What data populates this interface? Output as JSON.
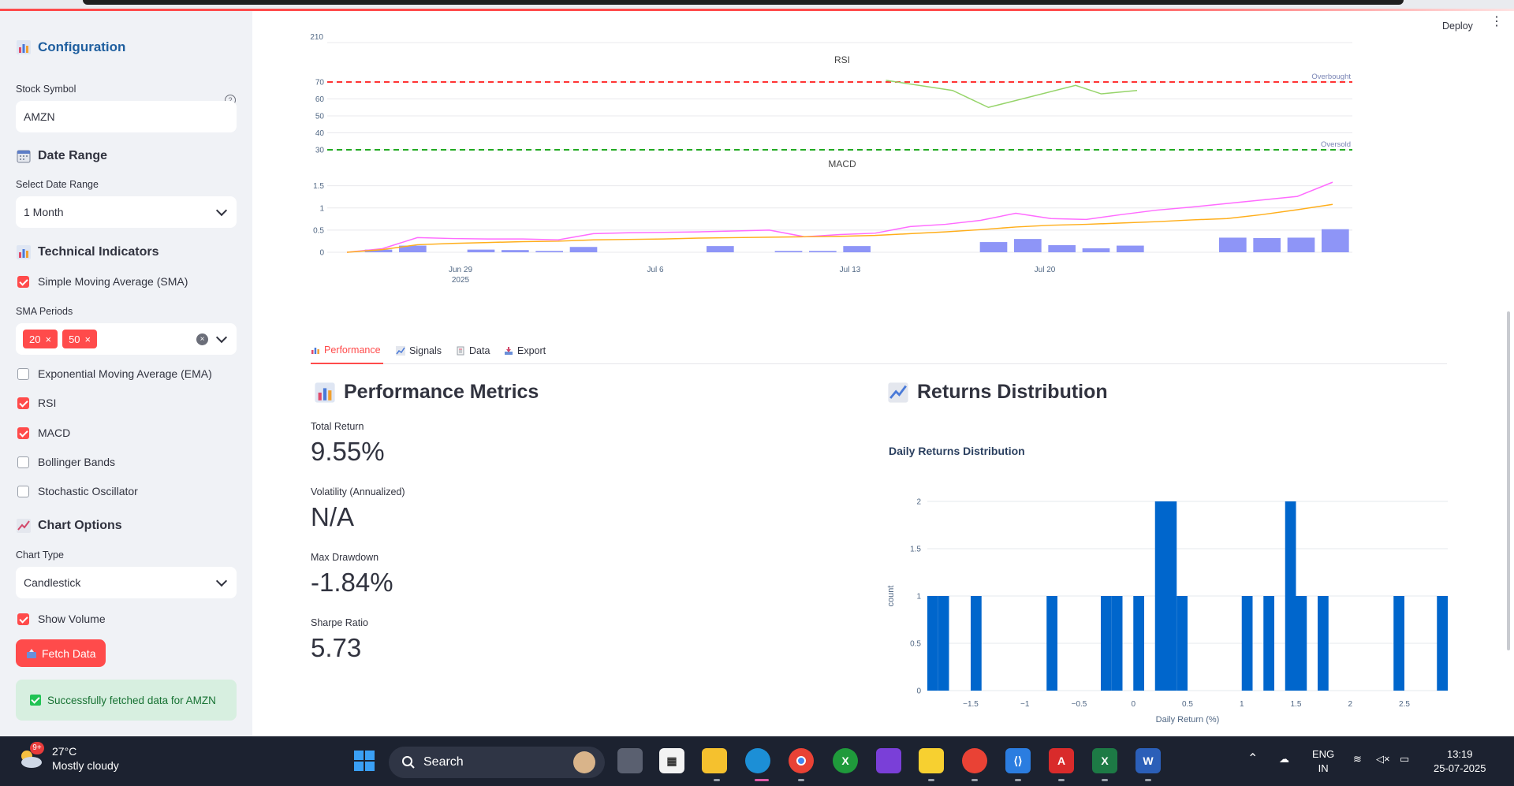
{
  "sidebar": {
    "config_title": "Configuration",
    "stock_symbol_label": "Stock Symbol",
    "stock_symbol_value": "AMZN",
    "date_range_title": "Date Range",
    "select_date_range_label": "Select Date Range",
    "date_range_value": "1 Month",
    "tech_indicators_title": "Technical Indicators",
    "sma_label": "Simple Moving Average (SMA)",
    "sma_periods_label": "SMA Periods",
    "sma_periods": [
      "20",
      "50"
    ],
    "ema_label": "Exponential Moving Average (EMA)",
    "rsi_label": "RSI",
    "macd_label": "MACD",
    "bollinger_label": "Bollinger Bands",
    "stochastic_label": "Stochastic Oscillator",
    "chart_options_title": "Chart Options",
    "chart_type_label": "Chart Type",
    "chart_type_value": "Candlestick",
    "show_volume_label": "Show Volume",
    "fetch_button": "Fetch Data",
    "success_message": "Successfully fetched data for AMZN",
    "checked": {
      "sma": true,
      "ema": false,
      "rsi": true,
      "macd": true,
      "bollinger": false,
      "stochastic": false,
      "volume": true
    }
  },
  "header": {
    "deploy_label": "Deploy"
  },
  "tabs": [
    {
      "label": "Performance",
      "active": true
    },
    {
      "label": "Signals",
      "active": false
    },
    {
      "label": "Data",
      "active": false
    },
    {
      "label": "Export",
      "active": false
    }
  ],
  "performance": {
    "title": "Performance Metrics",
    "metrics": [
      {
        "label": "Total Return",
        "value": "9.55%"
      },
      {
        "label": "Volatility (Annualized)",
        "value": "N/A"
      },
      {
        "label": "Max Drawdown",
        "value": "-1.84%"
      },
      {
        "label": "Sharpe Ratio",
        "value": "5.73"
      }
    ]
  },
  "returns": {
    "title": "Returns Distribution",
    "chart_title": "Daily Returns Distribution"
  },
  "chart_data": [
    {
      "type": "line",
      "title": "RSI",
      "ytick_labels": [
        "70",
        "60",
        "50",
        "40",
        "30"
      ],
      "top_tick_partial": "210",
      "ylim": [
        30,
        70
      ],
      "x": [
        "Jun 29",
        "Jul 6",
        "Jul 13",
        "Jul 20"
      ],
      "x_sub": "2025",
      "reference_lines": [
        {
          "name": "Overbought",
          "y": 70,
          "color": "#ff3333"
        },
        {
          "name": "Oversold",
          "y": 30,
          "color": "#22aa22"
        }
      ],
      "series": [
        {
          "color": "#96d46a",
          "points": [
            [
              0.545,
              71
            ],
            [
              0.61,
              65
            ],
            [
              0.645,
              55
            ],
            [
              0.73,
              68
            ],
            [
              0.755,
              63
            ],
            [
              0.79,
              65
            ]
          ]
        }
      ]
    },
    {
      "type": "line+bar",
      "title": "MACD",
      "ytick_labels": [
        "1.5",
        "1",
        "0.5",
        "0"
      ],
      "ylim": [
        0,
        1.6
      ],
      "xtick_labels": [
        "Jun 29",
        "Jul 6",
        "Jul 13",
        "Jul 20"
      ],
      "xtick_sub": "2025",
      "series": [
        {
          "color": "#ff6bff",
          "values": [
            0.0,
            0.08,
            0.33,
            0.31,
            0.3,
            0.3,
            0.28,
            0.42,
            0.44,
            0.45,
            0.46,
            0.48,
            0.5,
            0.35,
            0.4,
            0.43,
            0.58,
            0.63,
            0.72,
            0.88,
            0.76,
            0.74,
            0.85,
            0.95,
            1.02,
            1.1,
            1.18,
            1.26,
            1.58
          ]
        },
        {
          "color": "#ffae1a",
          "values": [
            0.0,
            0.06,
            0.17,
            0.2,
            0.22,
            0.24,
            0.25,
            0.28,
            0.29,
            0.3,
            0.32,
            0.33,
            0.34,
            0.35,
            0.36,
            0.38,
            0.42,
            0.46,
            0.51,
            0.57,
            0.61,
            0.63,
            0.66,
            0.69,
            0.73,
            0.76,
            0.85,
            0.96,
            1.08
          ]
        }
      ],
      "histogram": {
        "color": "#8e95f7",
        "values": [
          0.0,
          0.06,
          0.15,
          0.0,
          0.06,
          0.05,
          0.03,
          0.12,
          0.0,
          0.0,
          0.0,
          0.14,
          0.0,
          0.03,
          0.03,
          0.14,
          0.0,
          0.0,
          0.0,
          0.23,
          0.3,
          0.16,
          0.09,
          0.15,
          0.0,
          0.0,
          0.33,
          0.32,
          0.33,
          0.52
        ]
      }
    },
    {
      "type": "bar",
      "title": "Daily Returns Distribution",
      "xlabel": "Daily Return (%)",
      "ylabel": "count",
      "xtick_labels": [
        "−1.5",
        "−1",
        "−0.5",
        "0",
        "0.5",
        "1",
        "1.5",
        "2",
        "2.5"
      ],
      "ytick_labels": [
        "0",
        "0.5",
        "1",
        "1.5",
        "2"
      ],
      "xlim": [
        -1.9,
        2.9
      ],
      "ylim": [
        0,
        2
      ],
      "bin_width": 0.1,
      "color": "#0066cc",
      "bins": [
        {
          "x": -1.85,
          "count": 1
        },
        {
          "x": -1.75,
          "count": 1
        },
        {
          "x": -1.45,
          "count": 1
        },
        {
          "x": -0.75,
          "count": 1
        },
        {
          "x": -0.25,
          "count": 1
        },
        {
          "x": -0.15,
          "count": 1
        },
        {
          "x": 0.05,
          "count": 1
        },
        {
          "x": 0.25,
          "count": 2
        },
        {
          "x": 0.35,
          "count": 2
        },
        {
          "x": 0.45,
          "count": 1
        },
        {
          "x": 1.05,
          "count": 1
        },
        {
          "x": 1.25,
          "count": 1
        },
        {
          "x": 1.45,
          "count": 2
        },
        {
          "x": 1.55,
          "count": 1
        },
        {
          "x": 1.75,
          "count": 1
        },
        {
          "x": 2.45,
          "count": 1
        },
        {
          "x": 2.85,
          "count": 1
        }
      ]
    }
  ],
  "taskbar": {
    "weather_temp": "27°C",
    "weather_desc": "Mostly cloudy",
    "badge": "9+",
    "search_label": "Search",
    "lang_1": "ENG",
    "lang_2": "IN",
    "time": "13:19",
    "date": "25-07-2025"
  }
}
